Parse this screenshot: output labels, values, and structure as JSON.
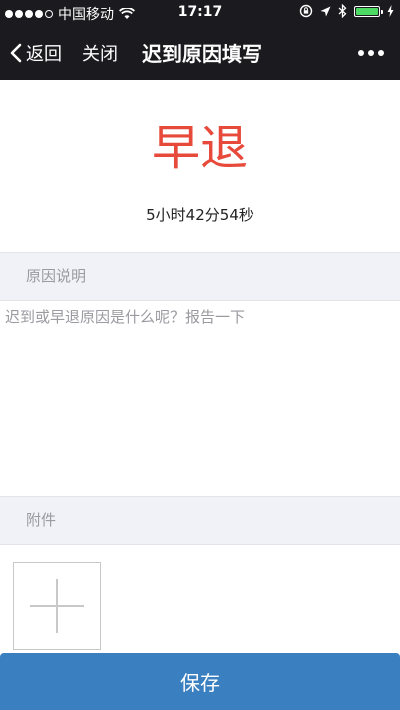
{
  "status_bar": {
    "carrier": "中国移动",
    "time": "17:17"
  },
  "nav": {
    "back_label": "返回",
    "close_label": "关闭",
    "title": "迟到原因填写"
  },
  "main": {
    "status_label": "早退",
    "duration": "5小时42分54秒",
    "reason_section_title": "原因说明",
    "reason_placeholder": "迟到或早退原因是什么呢？报告一下",
    "attachment_section_title": "附件",
    "save_label": "保存"
  },
  "colors": {
    "status_red": "#e7493b",
    "button_blue": "#3a7fc0",
    "nav_bg": "#1b1b1f",
    "section_bg": "#f0f2f7"
  },
  "icons": [
    "signal-icon",
    "wifi-icon",
    "lock-rotation-icon",
    "location-icon",
    "bluetooth-icon",
    "battery-icon",
    "back-chevron-icon",
    "more-icon",
    "plus-icon"
  ]
}
